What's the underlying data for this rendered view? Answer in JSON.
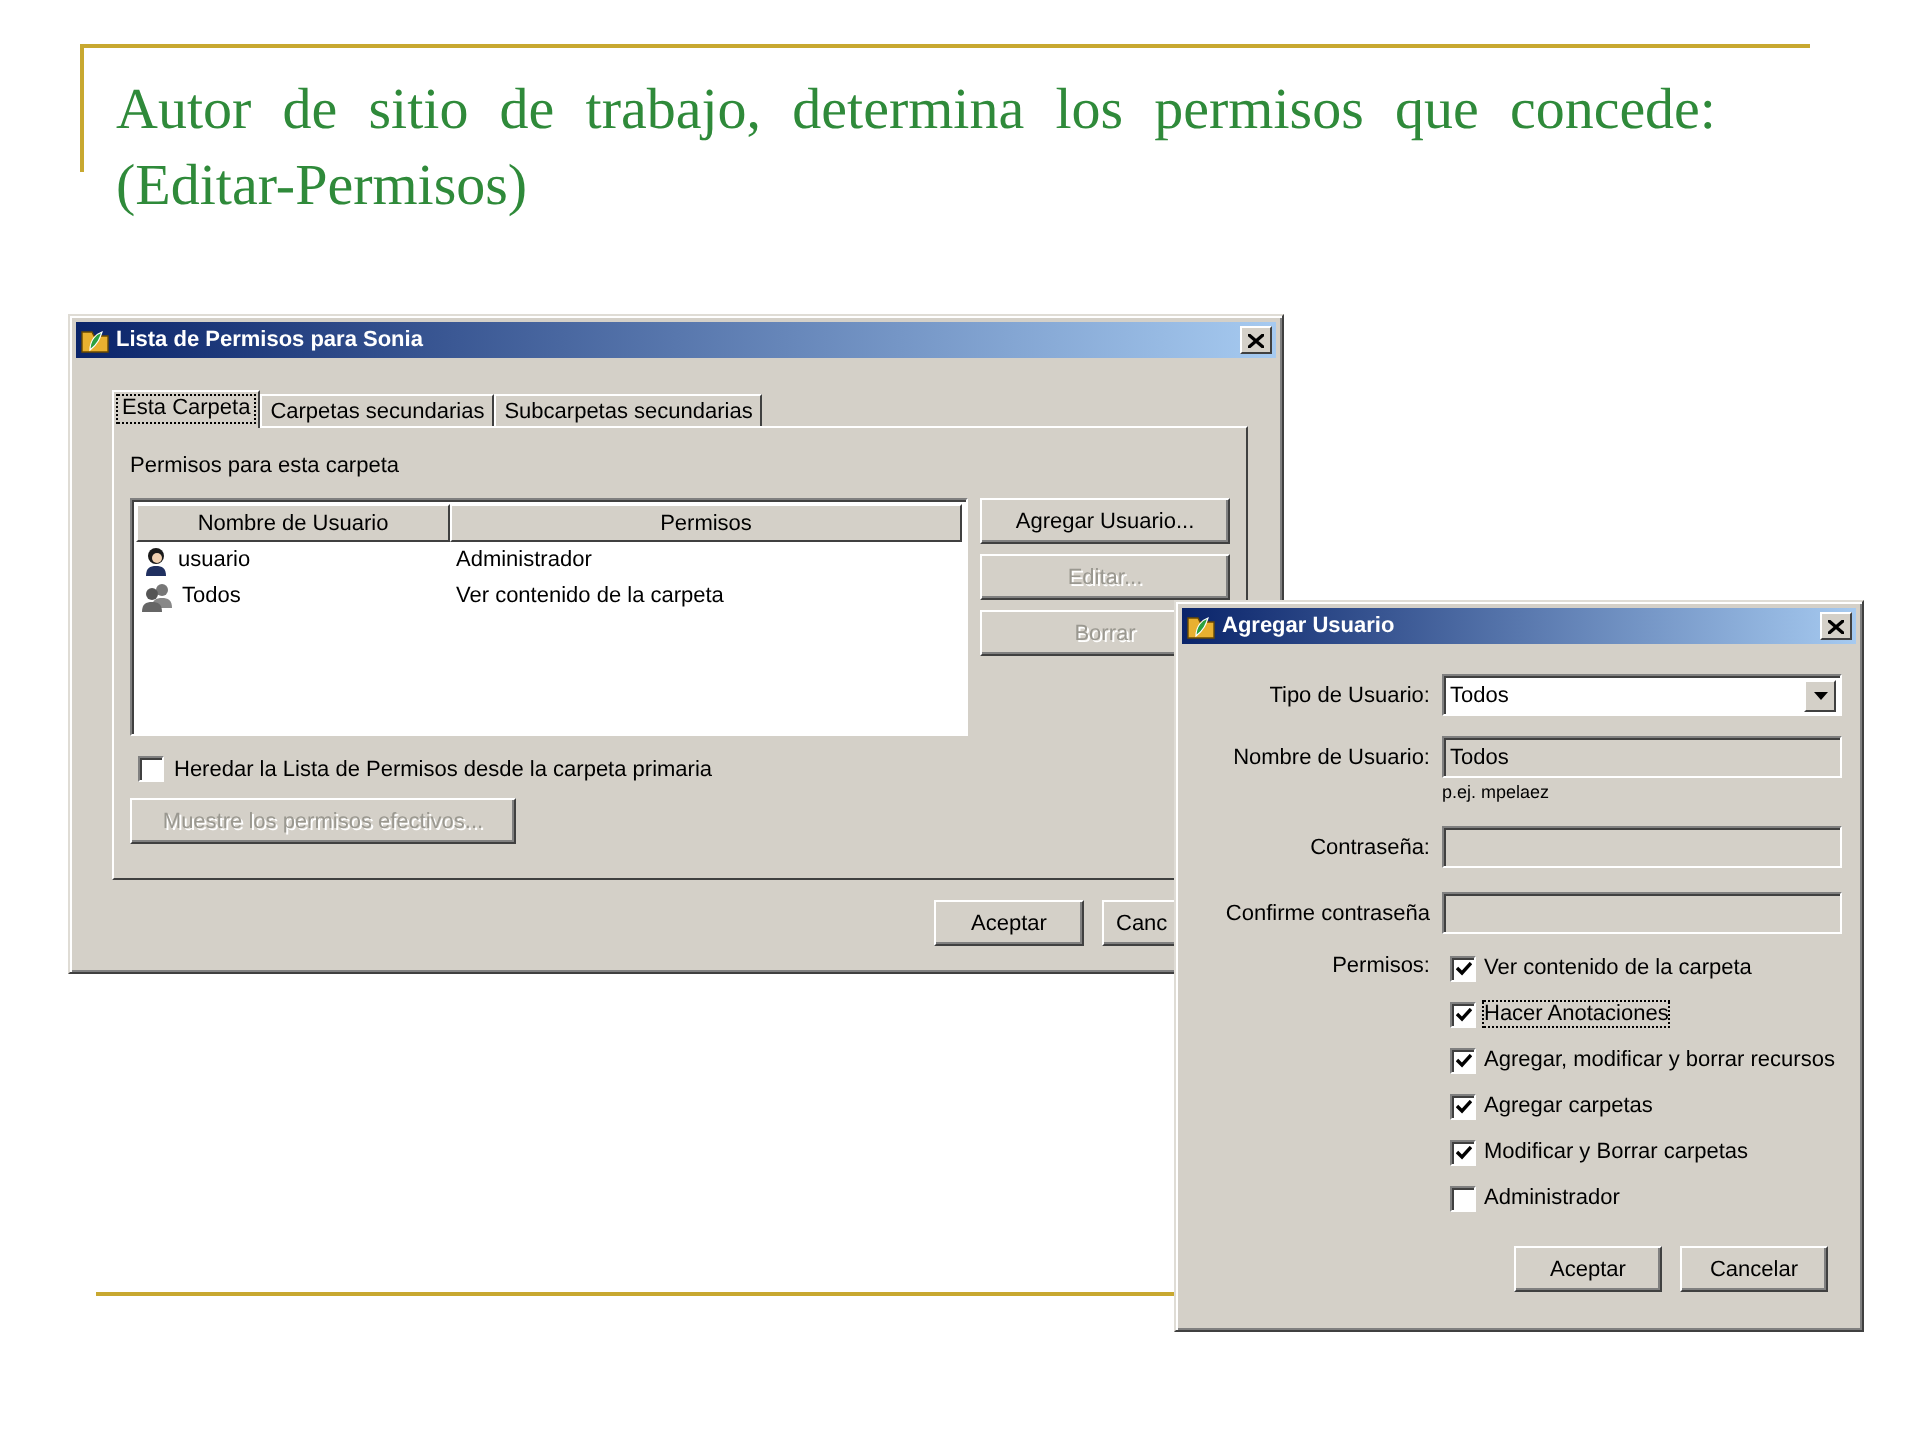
{
  "slide": {
    "title": "Autor de sitio de trabajo, determina los permisos que concede: (Editar-Permisos)"
  },
  "permissions_window": {
    "title": "Lista de Permisos para Sonia",
    "tabs": [
      {
        "label": "Esta Carpeta",
        "selected": true
      },
      {
        "label": "Carpetas secundarias",
        "selected": false
      },
      {
        "label": "Subcarpetas secundarias",
        "selected": false
      }
    ],
    "section_label": "Permisos para esta carpeta",
    "table": {
      "columns": [
        "Nombre de Usuario",
        "Permisos"
      ],
      "rows": [
        {
          "kind": "user",
          "cells": [
            "usuario",
            "Administrador"
          ]
        },
        {
          "kind": "group",
          "cells": [
            "Todos",
            "Ver contenido de la carpeta"
          ]
        }
      ]
    },
    "side_buttons": [
      {
        "label": "Agregar Usuario...",
        "disabled": false
      },
      {
        "label": "Editar...",
        "disabled": true
      },
      {
        "label": "Borrar",
        "disabled": true
      }
    ],
    "inherit_checkbox": {
      "label": "Heredar la Lista de Permisos desde la carpeta primaria",
      "checked": false
    },
    "effective_button": {
      "label": "Muestre los permisos efectivos...",
      "disabled": true
    },
    "buttons": [
      "Aceptar",
      "Canc"
    ]
  },
  "add_user_window": {
    "title": "Agregar Usuario",
    "user_type": {
      "label": "Tipo de Usuario:",
      "value": "Todos"
    },
    "user_name": {
      "label": "Nombre de Usuario:",
      "value": "Todos",
      "disabled": true,
      "hint": "p.ej. mpelaez"
    },
    "password": {
      "label": "Contraseña:"
    },
    "confirm_password": {
      "label": "Confirme contraseña"
    },
    "permissions_label": "Permisos:",
    "permissions": [
      {
        "label": "Ver contenido de la carpeta",
        "checked": true,
        "focused": false
      },
      {
        "label": "Hacer Anotaciones",
        "checked": true,
        "focused": true
      },
      {
        "label": "Agregar, modificar y borrar recursos",
        "checked": true,
        "focused": false
      },
      {
        "label": "Agregar carpetas",
        "checked": true,
        "focused": false
      },
      {
        "label": "Modificar y Borrar carpetas",
        "checked": true,
        "focused": false
      },
      {
        "label": "Administrador",
        "checked": false,
        "focused": false
      }
    ],
    "buttons": [
      "Aceptar",
      "Cancelar"
    ]
  }
}
